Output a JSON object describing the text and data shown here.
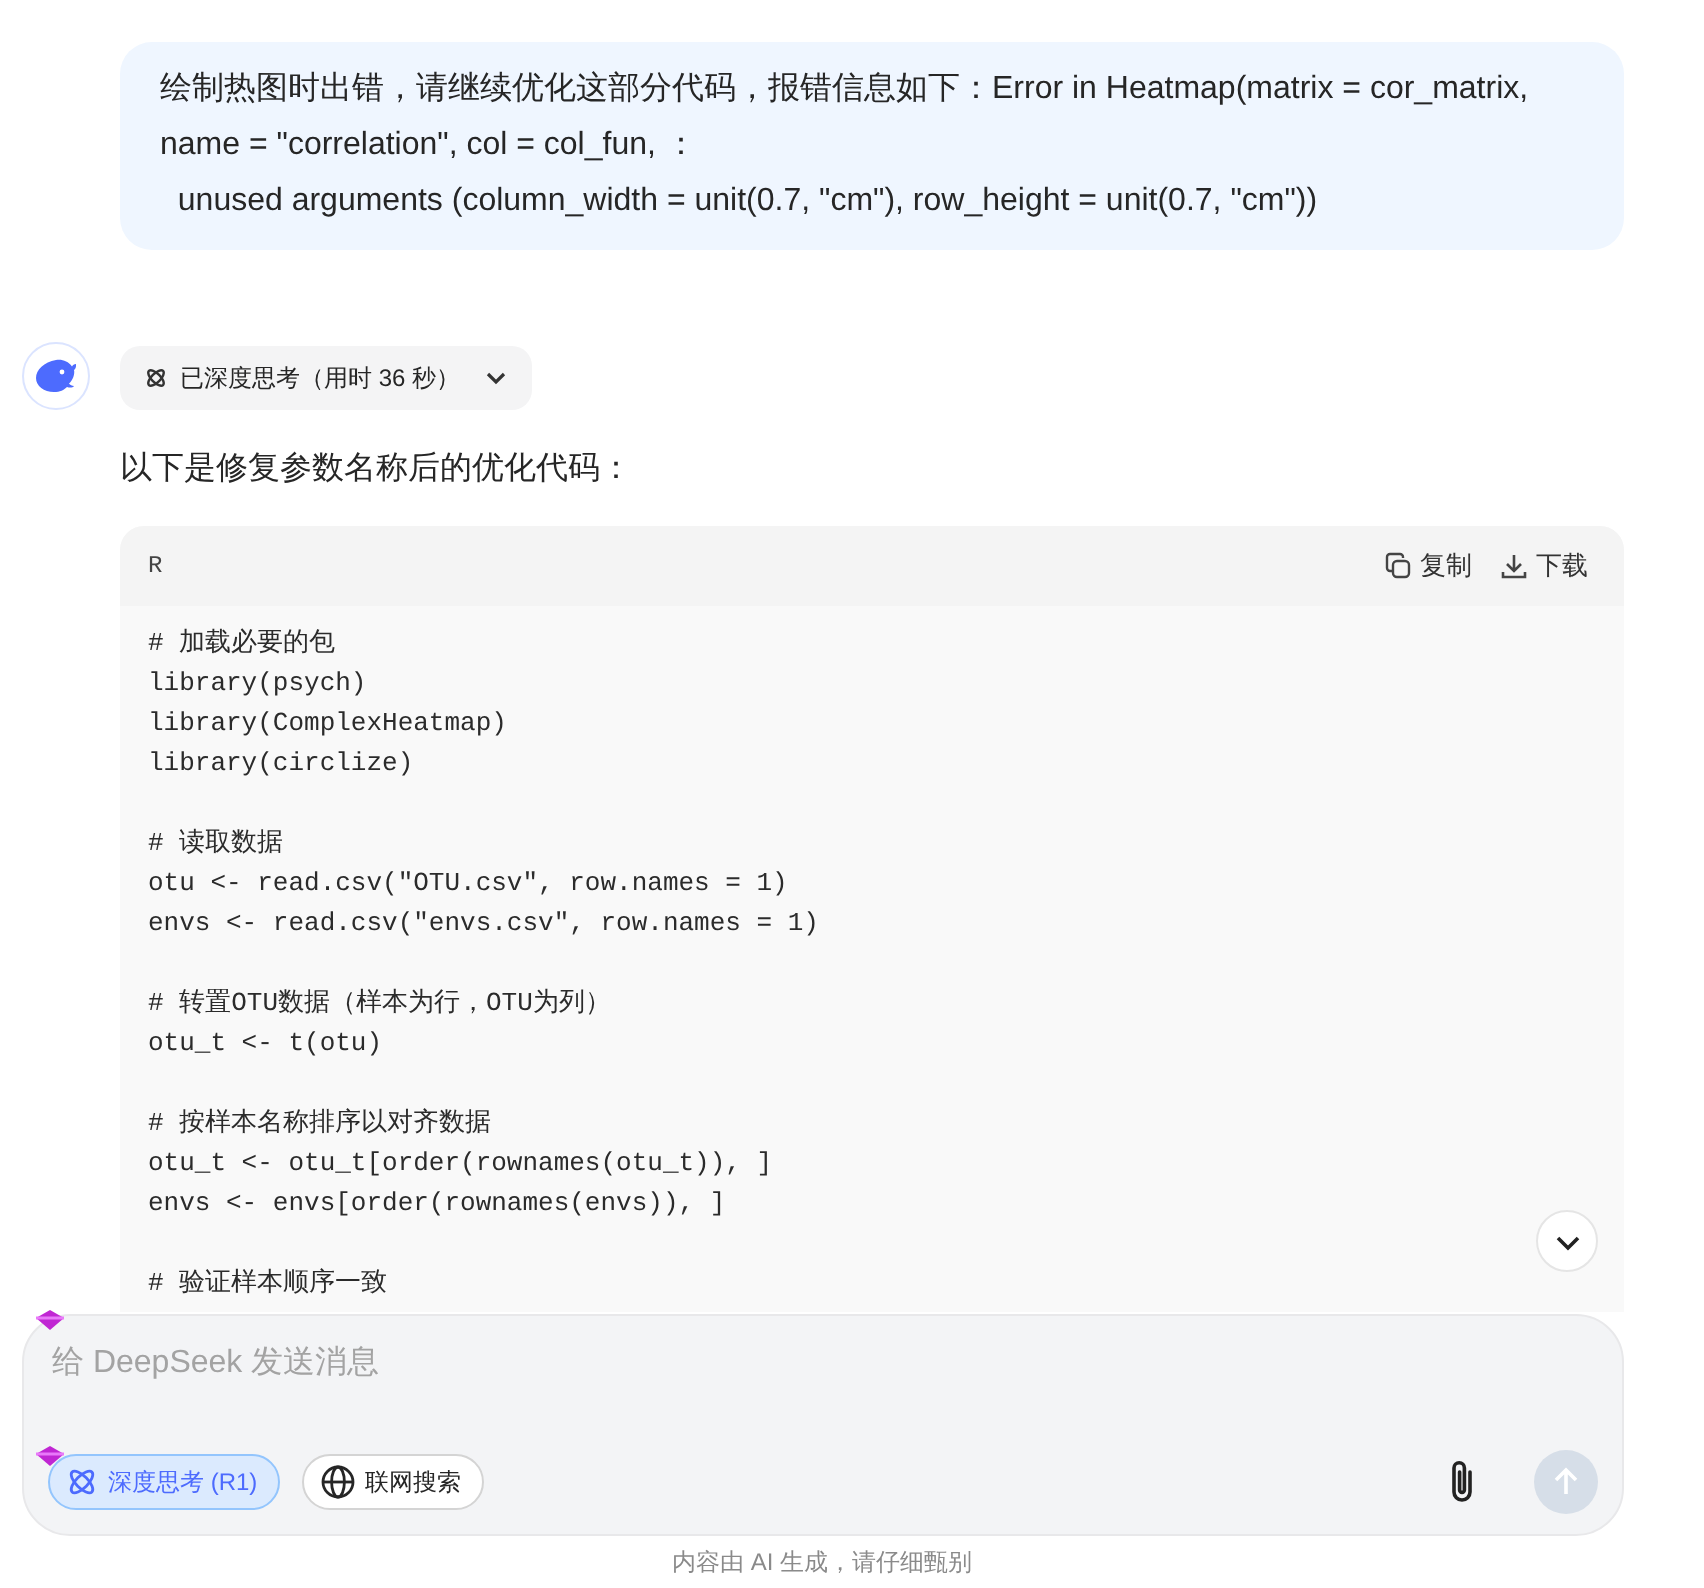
{
  "user_message": {
    "lines": [
      "绘制热图时出错，请继续优化这部分代码，报错信息如下：Error in Heatmap(matrix = cor_matrix,",
      "name = \"correlation\", col = col_fun, ：",
      "  unused arguments (column_width = unit(0.7, \"cm\"), row_height = unit(0.7, \"cm\"))"
    ]
  },
  "assistant": {
    "thinking": {
      "label": "已深度思考（用时 36 秒）",
      "expanded": false
    },
    "intro": "以下是修复参数名称后的优化代码：",
    "code_block": {
      "language": "R",
      "actions": [
        {
          "kind": "copy",
          "label": "复制"
        },
        {
          "kind": "download",
          "label": "下载"
        }
      ],
      "groups": [
        [
          "# 加载必要的包",
          "library(psych)",
          "library(ComplexHeatmap)",
          "library(circlize)"
        ],
        [
          "# 读取数据",
          "otu <- read.csv(\"OTU.csv\", row.names = 1)",
          "envs <- read.csv(\"envs.csv\", row.names = 1)"
        ],
        [
          "# 转置OTU数据（样本为行，OTU为列）",
          "otu_t <- t(otu)"
        ],
        [
          "# 按样本名称排序以对齐数据",
          "otu_t <- otu_t[order(rownames(otu_t)), ]",
          "envs <- envs[order(rownames(envs)), ]"
        ],
        [
          "# 验证样本顺序一致"
        ]
      ]
    }
  },
  "composer": {
    "placeholder": "给 DeepSeek 发送消息",
    "toggles": [
      {
        "kind": "deep_think",
        "label": "深度思考 (R1)",
        "selected": true
      },
      {
        "kind": "web_search",
        "label": "联网搜索",
        "selected": false
      }
    ],
    "send_disabled": true
  },
  "footer": "内容由 AI 生成，请仔细甄别"
}
